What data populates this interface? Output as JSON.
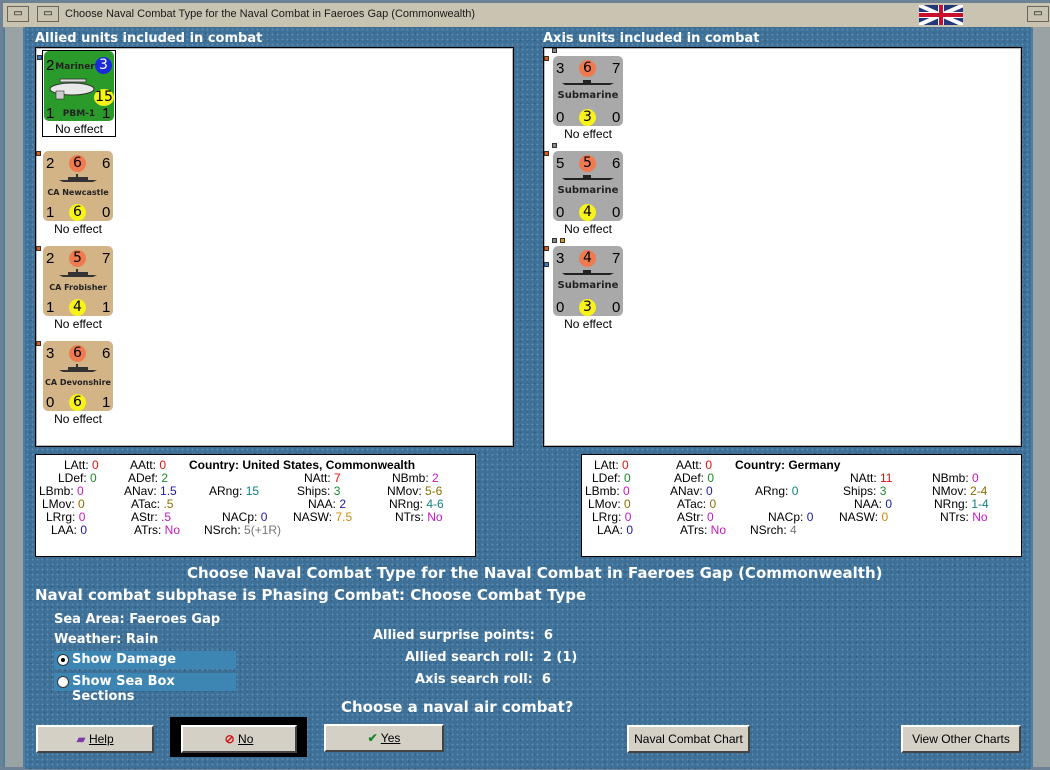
{
  "window": {
    "title": "Choose Naval Combat Type for the Naval Combat in Faeroes Gap (Commonwealth)"
  },
  "allied": {
    "header": "Allied units included in combat",
    "units": [
      {
        "top_left": "2",
        "name": "Mariner",
        "circle_tr": "3",
        "circle_mid": "15",
        "bottom_left": "1",
        "bottom_name": "PBM-1",
        "bottom_right": "1",
        "effect": "No effect",
        "type": "air",
        "color": "#2a9a2a"
      },
      {
        "top_left": "2",
        "top_mid": "6",
        "top_right": "6",
        "name": "CA Newcastle",
        "bottom_left": "1",
        "bottom_mid": "6",
        "bottom_right": "0",
        "effect": "No effect",
        "type": "ship",
        "color": "#d2b487"
      },
      {
        "top_left": "2",
        "top_mid": "5",
        "top_right": "7",
        "name": "CA Frobisher",
        "bottom_left": "1",
        "bottom_mid": "4",
        "bottom_right": "1",
        "effect": "No effect",
        "type": "ship",
        "color": "#d2b487"
      },
      {
        "top_left": "3",
        "top_mid": "6",
        "top_right": "6",
        "name": "CA Devonshire",
        "bottom_left": "0",
        "bottom_mid": "6",
        "bottom_right": "1",
        "effect": "No effect",
        "type": "ship",
        "color": "#d2b487"
      }
    ],
    "stats": {
      "country_label": "Country:",
      "country": "United States, Commonwealth",
      "LAtt": "0",
      "LDef": "0",
      "LBmb": "0",
      "LMov": "0",
      "LRrg": "0",
      "LAA": "0",
      "AAtt": "0",
      "ADef": "2",
      "ANav": "1.5",
      "ATac": ".5",
      "AStr": ".5",
      "ATrs": "No",
      "ARng": "15",
      "NACp": "0",
      "NSrch": "5(+1R)",
      "NAtt": "7",
      "Ships": "3",
      "NAA": "2",
      "NASW": "7.5",
      "NBmb": "2",
      "NMov": "5-6",
      "NRng": "4-6",
      "NTrs": "No"
    }
  },
  "axis": {
    "header": "Axis units included in combat",
    "units": [
      {
        "top_left": "3",
        "top_mid": "6",
        "top_right": "7",
        "name": "Submarine",
        "bottom_left": "0",
        "bottom_mid": "3",
        "bottom_right": "0",
        "effect": "No effect"
      },
      {
        "top_left": "5",
        "top_mid": "5",
        "top_right": "6",
        "name": "Submarine",
        "bottom_left": "0",
        "bottom_mid": "4",
        "bottom_right": "0",
        "effect": "No effect"
      },
      {
        "top_left": "3",
        "top_mid": "4",
        "top_right": "7",
        "name": "Submarine",
        "bottom_left": "0",
        "bottom_mid": "3",
        "bottom_right": "0",
        "effect": "No effect"
      }
    ],
    "stats": {
      "country_label": "Country:",
      "country": "Germany",
      "LAtt": "0",
      "LDef": "0",
      "LBmb": "0",
      "LMov": "0",
      "LRrg": "0",
      "LAA": "0",
      "AAtt": "0",
      "ADef": "0",
      "ANav": "0",
      "ATac": "0",
      "AStr": "0",
      "ATrs": "No",
      "ARng": "0",
      "NACp": "0",
      "NSrch": "4",
      "NAtt": "11",
      "Ships": "3",
      "NAA": "0",
      "NASW": "0",
      "NBmb": "0",
      "NMov": "2-4",
      "NRng": "1-4",
      "NTrs": "No"
    }
  },
  "combat": {
    "title": "Choose Naval Combat Type for the Naval Combat in Faeroes Gap (Commonwealth)",
    "subphase": "Naval combat subphase is Phasing Combat: Choose Combat Type",
    "sea_area_label": "Sea Area:",
    "sea_area": "Faeroes Gap",
    "weather_label": "Weather:",
    "weather": "Rain",
    "show_damage": "Show Damage",
    "show_sea_box": "Show Sea Box Sections",
    "allied_surprise_label": "Allied surprise points:",
    "allied_surprise": "6",
    "allied_search_label": "Allied search roll:",
    "allied_search": "2 (1)",
    "axis_search_label": "Axis search roll:",
    "axis_search": "6",
    "question": "Choose a naval air combat?"
  },
  "buttons": {
    "help": "Help",
    "no": "No",
    "yes": "Yes",
    "naval_chart": "Naval Combat Chart",
    "other_charts": "View Other Charts"
  },
  "colors": {
    "allied_air": "#2a9a2a",
    "ship_counter": "#d2b487",
    "sub_counter": "#a9a9a9",
    "attack_circle": "#ef7a4f",
    "def_circle": "#f7f219",
    "blue_circle": "#1a2bdc"
  }
}
